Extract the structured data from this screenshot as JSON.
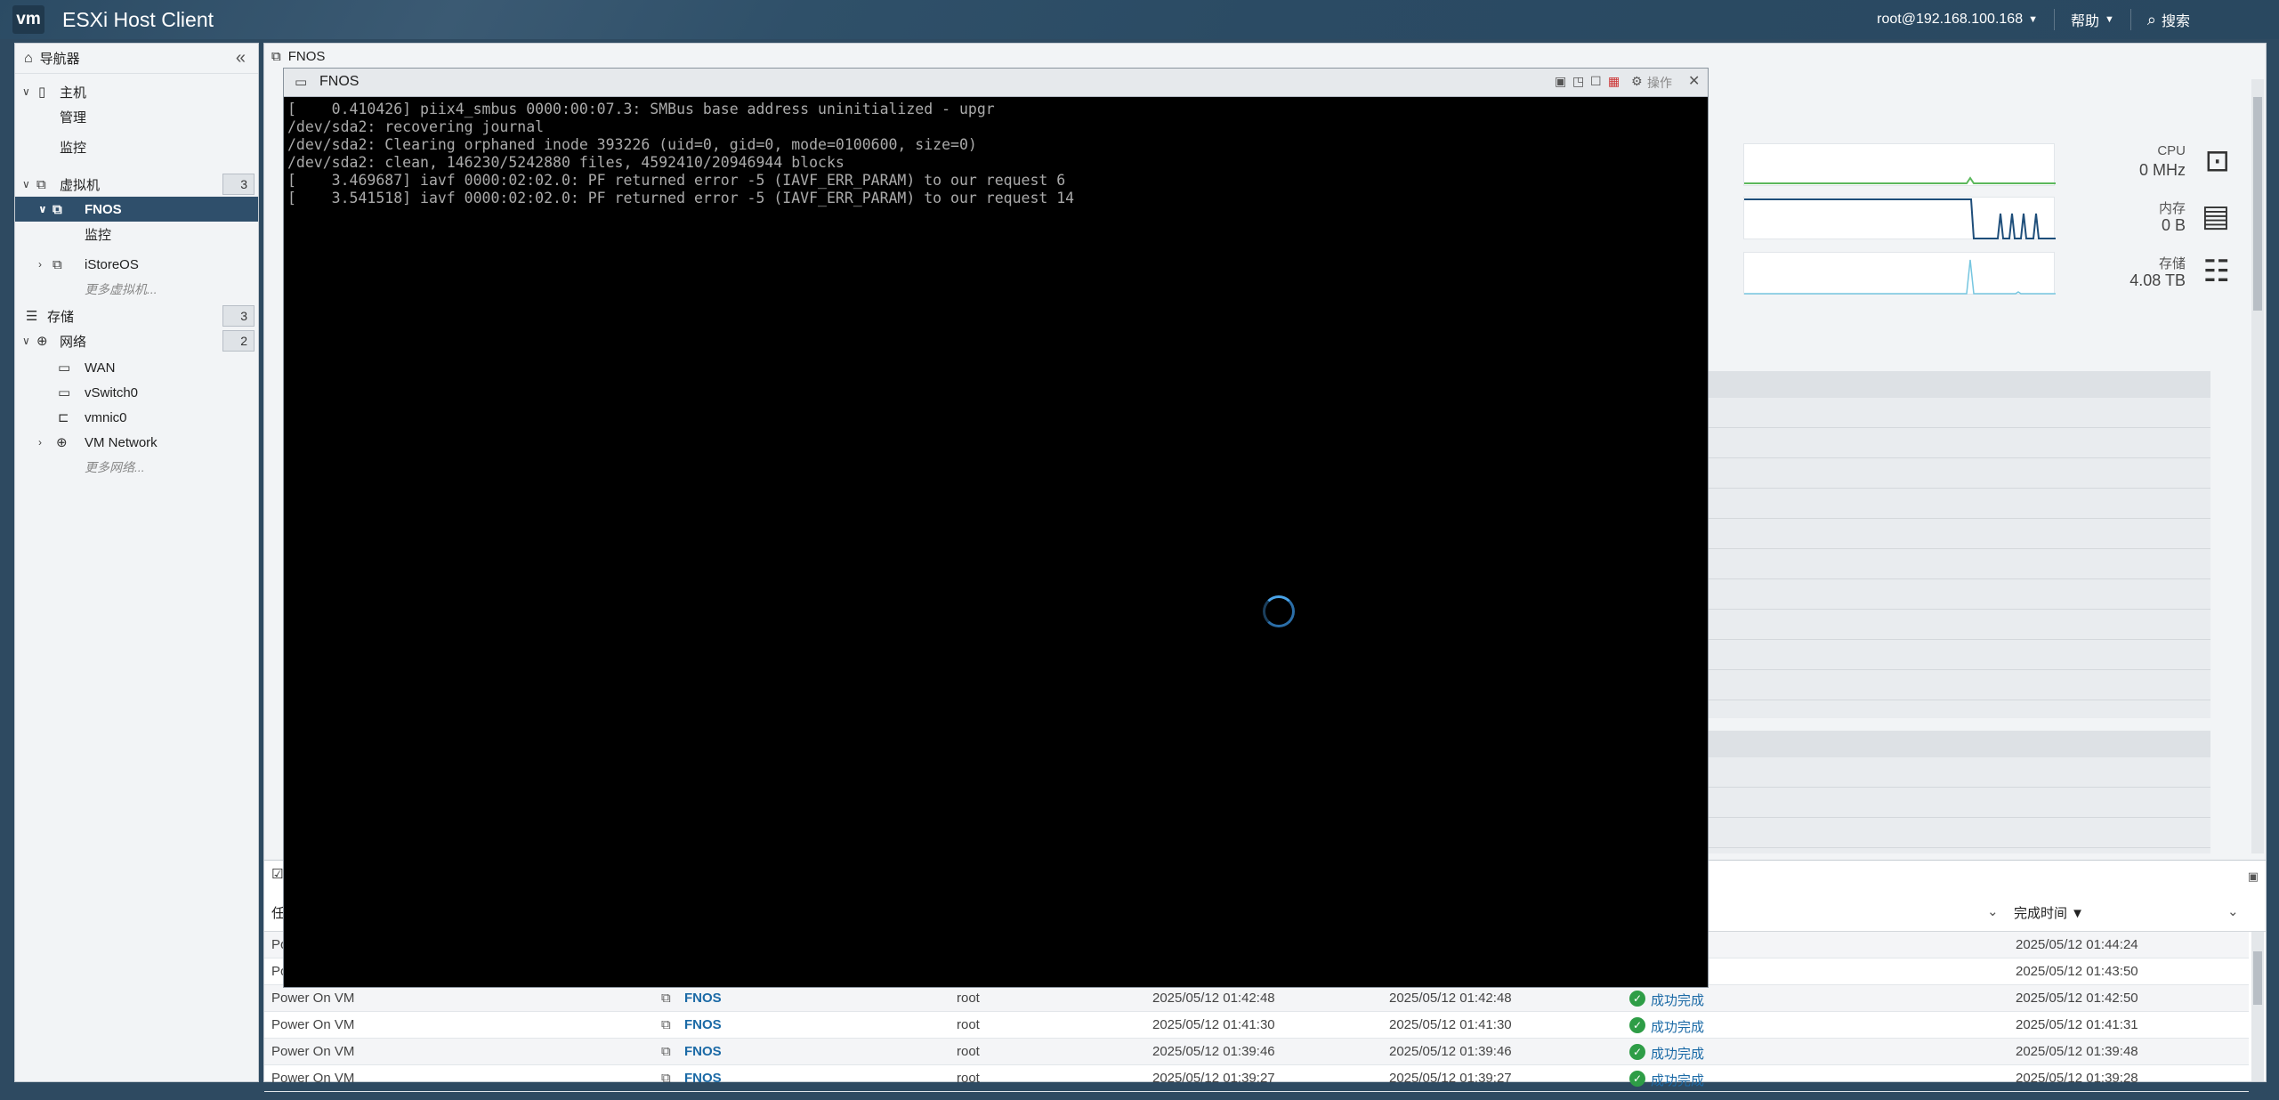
{
  "header": {
    "logo": "vm",
    "title": "ESXi Host Client",
    "user": "root@192.168.100.168",
    "help": "帮助",
    "search": "搜索"
  },
  "sidebar": {
    "title": "导航器",
    "host": "主机",
    "host_manage": "管理",
    "host_monitor": "监控",
    "vms": "虚拟机",
    "vms_count": "3",
    "vm_selected": "FNOS",
    "vm_monitor": "监控",
    "vm_other": "iStoreOS",
    "vm_more": "更多虚拟机...",
    "storage": "存储",
    "storage_count": "3",
    "network": "网络",
    "network_count": "2",
    "net_items": [
      "WAN",
      "vSwitch0",
      "vmnic0",
      "VM Network"
    ],
    "net_more": "更多网络..."
  },
  "main": {
    "tab_title": "FNOS",
    "stats": {
      "cpu_label": "CPU",
      "cpu_value": "0 MHz",
      "mem_label": "内存",
      "mem_value": "0 B",
      "storage_label": "存储",
      "storage_value": "4.08 TB"
    }
  },
  "tasks": {
    "col_done": "完成时间 ▼",
    "col_task_initial": "任",
    "rows": [
      {
        "task": "Po",
        "target": "",
        "initiator": "",
        "queued": "",
        "started": "",
        "result": "",
        "completed": "2025/05/12 01:44:24"
      },
      {
        "task": "Po",
        "target": "",
        "initiator": "",
        "queued": "",
        "started": "",
        "result": "",
        "completed": "2025/05/12 01:43:50"
      },
      {
        "task": "Power On VM",
        "target": "FNOS",
        "initiator": "root",
        "queued": "2025/05/12 01:42:48",
        "started": "2025/05/12 01:42:48",
        "result": "成功完成",
        "completed": "2025/05/12 01:42:50"
      },
      {
        "task": "Power On VM",
        "target": "FNOS",
        "initiator": "root",
        "queued": "2025/05/12 01:41:30",
        "started": "2025/05/12 01:41:30",
        "result": "成功完成",
        "completed": "2025/05/12 01:41:31"
      },
      {
        "task": "Power On VM",
        "target": "FNOS",
        "initiator": "root",
        "queued": "2025/05/12 01:39:46",
        "started": "2025/05/12 01:39:46",
        "result": "成功完成",
        "completed": "2025/05/12 01:39:48"
      },
      {
        "task": "Power On VM",
        "target": "FNOS",
        "initiator": "root",
        "queued": "2025/05/12 01:39:27",
        "started": "2025/05/12 01:39:27",
        "result": "成功完成",
        "completed": "2025/05/12 01:39:28"
      }
    ]
  },
  "console": {
    "title": "FNOS",
    "actions": "操作",
    "lines": [
      "[    0.410426] piix4_smbus 0000:00:07.3: SMBus base address uninitialized - upgr",
      "/dev/sda2: recovering journal",
      "/dev/sda2: Clearing orphaned inode 393226 (uid=0, gid=0, mode=0100600, size=0)",
      "/dev/sda2: clean, 146230/5242880 files, 4592410/20946944 blocks",
      "[    3.469687] iavf 0000:02:02.0: PF returned error -5 (IAVF_ERR_PARAM) to our request 6",
      "[    3.541518] iavf 0000:02:02.0: PF returned error -5 (IAVF_ERR_PARAM) to our request 14"
    ]
  }
}
